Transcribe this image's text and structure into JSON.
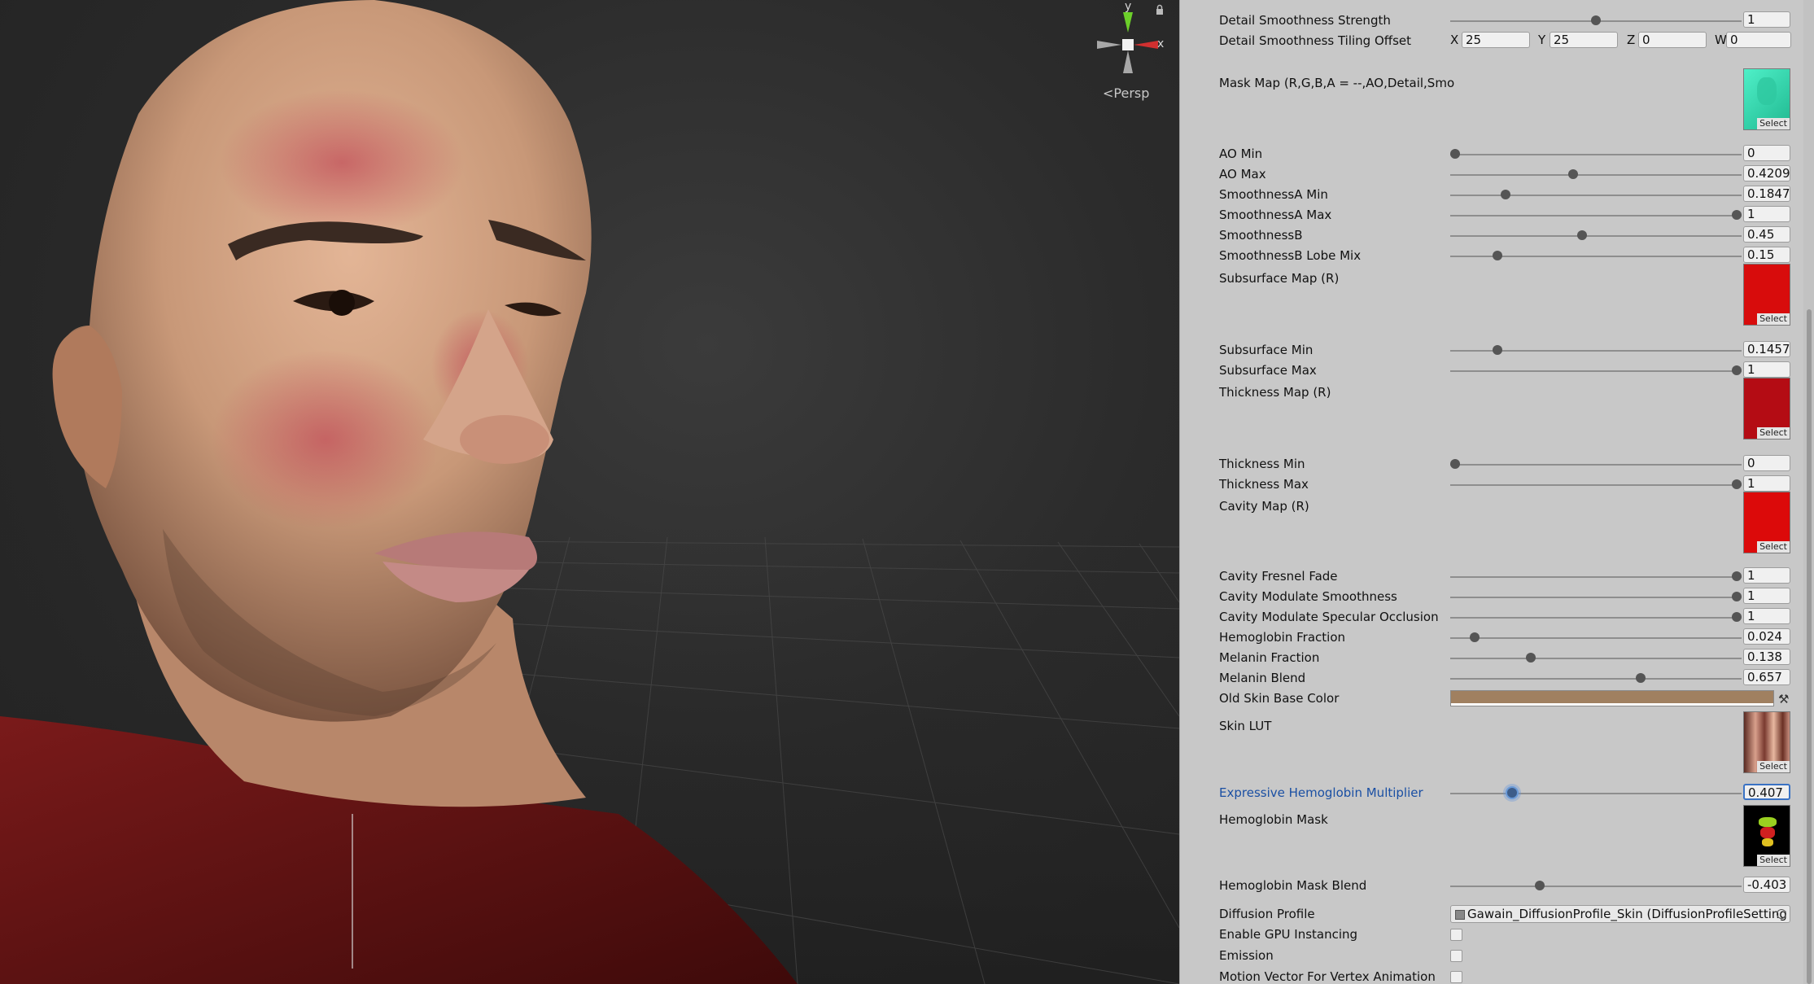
{
  "scene": {
    "projection_label": "Persp",
    "gizmo_axes": [
      "y",
      "x"
    ]
  },
  "inspector": {
    "top_rows": [
      {
        "label": "Detail Smoothness Strength",
        "value": "1",
        "fraction": 0.5
      }
    ],
    "tiling": {
      "label": "Detail Smoothness Tiling Offset",
      "x_label": "X",
      "x": "25",
      "y_label": "Y",
      "y": "25",
      "z_label": "Z",
      "z": "0",
      "w_label": "W",
      "w": "0"
    },
    "mask_map": {
      "label": "Mask Map (R,G,B,A = --,AO,Detail,Smo",
      "select": "Select",
      "color": "#3fe0b8"
    },
    "sliders_a": [
      {
        "label": "AO Min",
        "value": "0",
        "fraction": 0.0
      },
      {
        "label": "AO Max",
        "value": "0.42095",
        "fraction": 0.42
      },
      {
        "label": "SmoothnessA Min",
        "value": "0.18475",
        "fraction": 0.18
      },
      {
        "label": "SmoothnessA Max",
        "value": "1",
        "fraction": 1.0
      },
      {
        "label": "SmoothnessB",
        "value": "0.45",
        "fraction": 0.45
      },
      {
        "label": "SmoothnessB Lobe Mix",
        "value": "0.15",
        "fraction": 0.15
      }
    ],
    "subsurface_map": {
      "label": "Subsurface Map (R)",
      "select": "Select",
      "color": "#d80c0c"
    },
    "sliders_b": [
      {
        "label": "Subsurface Min",
        "value": "0.14578",
        "fraction": 0.15
      },
      {
        "label": "Subsurface Max",
        "value": "1",
        "fraction": 1.0
      }
    ],
    "thickness_map": {
      "label": "Thickness Map (R)",
      "select": "Select",
      "color": "#b80c14"
    },
    "sliders_c": [
      {
        "label": "Thickness Min",
        "value": "0",
        "fraction": 0.0
      },
      {
        "label": "Thickness Max",
        "value": "1",
        "fraction": 1.0
      }
    ],
    "cavity_map": {
      "label": "Cavity Map (R)",
      "select": "Select",
      "color": "#dc0a0a"
    },
    "sliders_d": [
      {
        "label": "Cavity Fresnel Fade",
        "value": "1",
        "fraction": 1.0
      },
      {
        "label": "Cavity Modulate Smoothness",
        "value": "1",
        "fraction": 1.0
      },
      {
        "label": "Cavity Modulate Specular Occlusion",
        "value": "1",
        "fraction": 1.0
      },
      {
        "label": "Hemoglobin Fraction",
        "value": "0.024",
        "fraction": 0.07
      },
      {
        "label": "Melanin Fraction",
        "value": "0.138",
        "fraction": 0.27
      },
      {
        "label": "Melanin Blend",
        "value": "0.657",
        "fraction": 0.66
      }
    ],
    "old_skin": {
      "label": "Old Skin Base Color",
      "color": "#a08060"
    },
    "skin_lut": {
      "label": "Skin LUT",
      "select": "Select"
    },
    "expressive": {
      "label": "Expressive Hemoglobin Multiplier",
      "value": "0.407",
      "fraction": 0.2
    },
    "hemoglobin_mask": {
      "label": "Hemoglobin Mask",
      "select": "Select"
    },
    "mask_blend": {
      "label": "Hemoglobin Mask Blend",
      "value": "-0.403",
      "fraction": 0.3
    },
    "diffusion": {
      "label": "Diffusion Profile",
      "value": "Gawain_DiffusionProfile_Skin (DiffusionProfileSetting"
    },
    "checks": [
      {
        "label": "Enable GPU Instancing"
      },
      {
        "label": "Emission"
      },
      {
        "label": "Motion Vector For Vertex Animation"
      }
    ]
  }
}
